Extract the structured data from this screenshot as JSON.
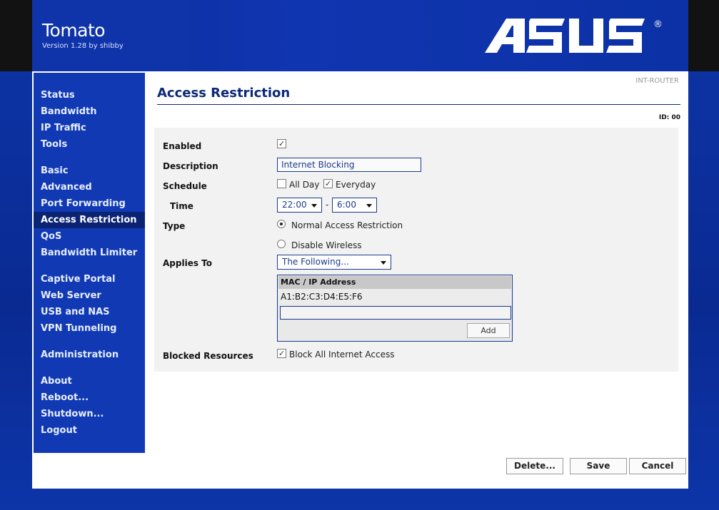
{
  "header": {
    "app_title": "Tomato",
    "version": "Version 1.28 by shibby",
    "logo_text": "ASUS",
    "logo_mark": "®"
  },
  "sidebar": {
    "groups": [
      [
        "Status",
        "Bandwidth",
        "IP Traffic",
        "Tools"
      ],
      [
        "Basic",
        "Advanced",
        "Port Forwarding",
        "Access Restriction",
        "QoS",
        "Bandwidth Limiter"
      ],
      [
        "Captive Portal",
        "Web Server",
        "USB and NAS",
        "VPN Tunneling"
      ],
      [
        "Administration"
      ],
      [
        "About",
        "Reboot...",
        "Shutdown...",
        "Logout"
      ]
    ],
    "active": "Access Restriction"
  },
  "content": {
    "router_name": "INT-ROUTER",
    "page_title": "Access Restriction",
    "id_label": "ID: 00"
  },
  "form": {
    "enabled_label": "Enabled",
    "enabled_checked": true,
    "description_label": "Description",
    "description_value": "Internet Blocking",
    "schedule_label": "Schedule",
    "all_day_label": "All Day",
    "all_day_checked": false,
    "everyday_label": "Everyday",
    "everyday_checked": true,
    "time_label": "Time",
    "time_start": "22:00",
    "time_separator": "-",
    "time_end": "6:00",
    "type_label": "Type",
    "type_normal": "Normal Access Restriction",
    "type_disable_wireless": "Disable Wireless",
    "type_selected": "normal",
    "applies_to_label": "Applies To",
    "applies_to_value": "The Following...",
    "mac_table": {
      "header": "MAC / IP Address",
      "rows": [
        "A1:B2:C3:D4:E5:F6"
      ],
      "input_value": "",
      "add_label": "Add"
    },
    "blocked_label": "Blocked Resources",
    "block_all_label": "Block All Internet Access",
    "block_all_checked": true
  },
  "buttons": {
    "delete": "Delete...",
    "save": "Save",
    "cancel": "Cancel"
  },
  "colors": {
    "background": "#0b2f9e",
    "sidebar": "#1139b4",
    "sidebar_active": "#0a2373",
    "title": "#0d2a78",
    "form_box": "#f2f2f2"
  }
}
